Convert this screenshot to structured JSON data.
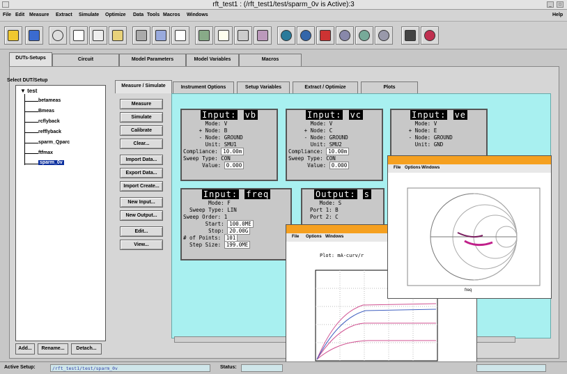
{
  "window": {
    "title": "rft_test1 : (/rft_test1/test/sparm_0v is Active):3"
  },
  "menubar": {
    "items": [
      "File",
      "Edit",
      "Measure",
      "Extract",
      "Simulate",
      "Optimize",
      "Data",
      "Tools",
      "Macros",
      "Windows"
    ],
    "help": "Help"
  },
  "toolbar": {
    "icons": [
      "open-icon",
      "save-icon",
      "undo-icon",
      "measure-icon",
      "copy-icon",
      "paste-icon",
      "schematic-icon",
      "monitor-icon",
      "data-icon",
      "chip-icon",
      "plot-icon",
      "print-icon",
      "camera-icon",
      "network-icon",
      "disk-icon",
      "probe-icon",
      "circle-icon",
      "gear-icon",
      "calculator-icon",
      "help-icon"
    ]
  },
  "top_tabs": [
    "DUTs-Setups",
    "Circuit",
    "Model Parameters",
    "Model Variables",
    "Macros"
  ],
  "left": {
    "label": "Select DUT/Setup",
    "root": "test",
    "items": [
      "betameas",
      "Bmeas",
      "rcflyback",
      "refflyback",
      "sparm_Qparc",
      "ftfmax",
      "sparm_0v"
    ],
    "buttons": [
      "Add...",
      "Rename...",
      "Detach..."
    ]
  },
  "sub_tabs": [
    "Measure / Simulate",
    "Instrument Options",
    "Setup Variables",
    "Extract / Optimize",
    "Plots"
  ],
  "actions": {
    "group1": [
      "Measure",
      "Simulate",
      "Calibrate",
      "Clear..."
    ],
    "group2": [
      "Import Data...",
      "Export Data...",
      "Import Create..."
    ],
    "group3": [
      "New Input...",
      "New Output..."
    ],
    "group4": [
      "Edit...",
      "View..."
    ]
  },
  "inputs": [
    {
      "label": "Input:",
      "name": "vb",
      "rows": [
        [
          "Mode:",
          "V"
        ],
        [
          "+ Node:",
          "B"
        ],
        [
          "- Node:",
          "GROUND"
        ],
        [
          "Unit:",
          "SMU1"
        ],
        [
          "Compliance:",
          "10.00m"
        ],
        [
          "Sweep Type:",
          "CON"
        ],
        [
          "Value:",
          "0.000"
        ]
      ]
    },
    {
      "label": "Input:",
      "name": "vc",
      "rows": [
        [
          "Mode:",
          "V"
        ],
        [
          "+ Node:",
          "C"
        ],
        [
          "- Node:",
          "GROUND"
        ],
        [
          "Unit:",
          "SMU2"
        ],
        [
          "Compliance:",
          "10.00m"
        ],
        [
          "Sweep Type:",
          "CON"
        ],
        [
          "Value:",
          "0.000"
        ]
      ]
    },
    {
      "label": "Input:",
      "name": "ve",
      "rows": [
        [
          "Mode:",
          "V"
        ],
        [
          "+ Node:",
          "E"
        ],
        [
          "- Node:",
          "GROUND"
        ],
        [
          "Unit:",
          "GND"
        ]
      ]
    },
    {
      "label": "Input:",
      "name": "freq",
      "rows": [
        [
          "Mode:",
          "F"
        ],
        [
          "Sweep Type:",
          "LIN"
        ],
        [
          "Sweep Order:",
          "1"
        ],
        [
          "Start:",
          "100.0ME"
        ],
        [
          "Stop:",
          "20.00G"
        ],
        [
          "# of Points:",
          "101"
        ],
        [
          "Step Size:",
          "199.0ME"
        ]
      ]
    }
  ],
  "output": {
    "label": "Output:",
    "name": "s",
    "rows": [
      [
        "Mode:",
        "S"
      ],
      [
        "Port 1:",
        "B"
      ],
      [
        "Port 2:",
        "C"
      ]
    ]
  },
  "status": {
    "active_label": "Active Setup:",
    "active_value": "/rft_test1/test/sparm_0v",
    "status_label": "Status:"
  },
  "plot_small": {
    "menu": [
      "File",
      "Options",
      "Windows"
    ],
    "header": "Plot: mA-curv/r"
  },
  "plot_smith": {
    "menu": [
      "File",
      "Options",
      "Windows"
    ],
    "xlabel": "freq"
  },
  "colors": {
    "canvas": "#a8f0f0",
    "selection": "#0b2f9e",
    "plot_title": "#f5a020"
  }
}
